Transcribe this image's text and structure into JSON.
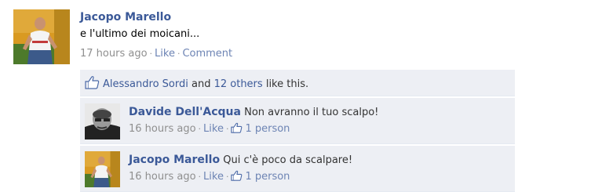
{
  "post": {
    "author": "Jacopo Marello",
    "text": "e l'ultimo dei moicani...",
    "time": "17 hours ago",
    "sep": "·",
    "like_label": "Like",
    "comment_label": "Comment"
  },
  "likes": {
    "liker": "Alessandro Sordi",
    "and_text": "and",
    "others_link": "12 others",
    "suffix": "like this."
  },
  "comments": [
    {
      "author": "Davide Dell'Acqua",
      "text": "Non avranno il tuo scalpo!",
      "time": "16 hours ago",
      "like_label": "Like",
      "like_count": "1 person"
    },
    {
      "author": "Jacopo Marello",
      "text": "Qui c'è poco da scalpare!",
      "time": "16 hours ago",
      "like_label": "Like",
      "like_count": "1 person"
    }
  ],
  "colors": {
    "link": "#3b5998",
    "muted": "#8f8f8f",
    "ufi_bg": "#edeff4"
  }
}
